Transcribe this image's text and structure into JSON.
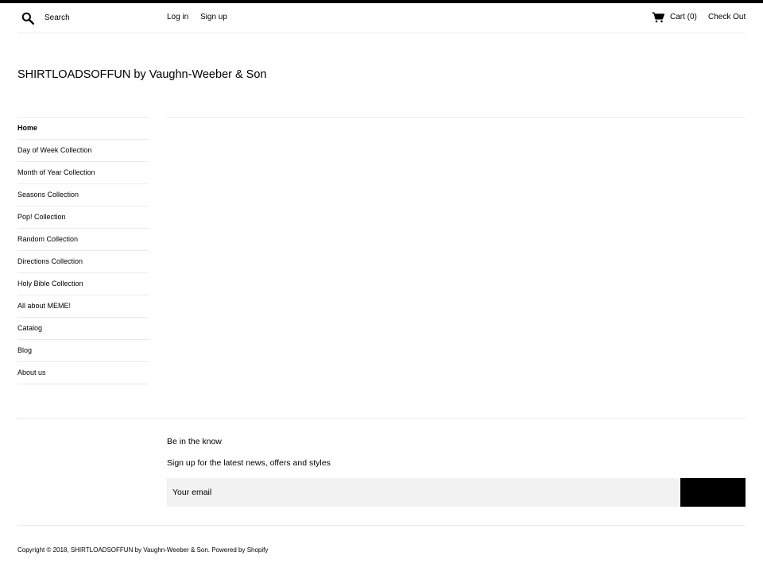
{
  "header": {
    "search_placeholder": "Search",
    "login_label": "Log in",
    "signup_label": "Sign up",
    "cart_label": "Cart (0)",
    "checkout_label": "Check Out"
  },
  "site": {
    "title": "SHIRTLOADSOFFUN by Vaughn-Weeber & Son"
  },
  "sidebar": {
    "items": [
      {
        "label": "Home"
      },
      {
        "label": "Day of Week Collection"
      },
      {
        "label": "Month of Year Collection"
      },
      {
        "label": "Seasons Collection"
      },
      {
        "label": "Pop! Collection"
      },
      {
        "label": "Random Collection"
      },
      {
        "label": "Directions Collection"
      },
      {
        "label": "Holy Bible Collection"
      },
      {
        "label": "All about MEME!"
      },
      {
        "label": "Catalog"
      },
      {
        "label": "Blog"
      },
      {
        "label": "About us"
      }
    ],
    "active_index": 0
  },
  "newsletter": {
    "heading": "Be in the know",
    "text": "Sign up for the latest news, offers and styles",
    "email_placeholder": "Your email"
  },
  "footer": {
    "copyright": "Copyright © 2018, SHIRTLOADSOFFUN by Vaughn-Weeber & Son. Powered by Shopify"
  },
  "icons": {
    "search": "search-icon",
    "cart": "cart-icon"
  },
  "colors": {
    "accent": "#000000",
    "divider": "#ebebeb",
    "input_bg": "#f2f2f2"
  }
}
